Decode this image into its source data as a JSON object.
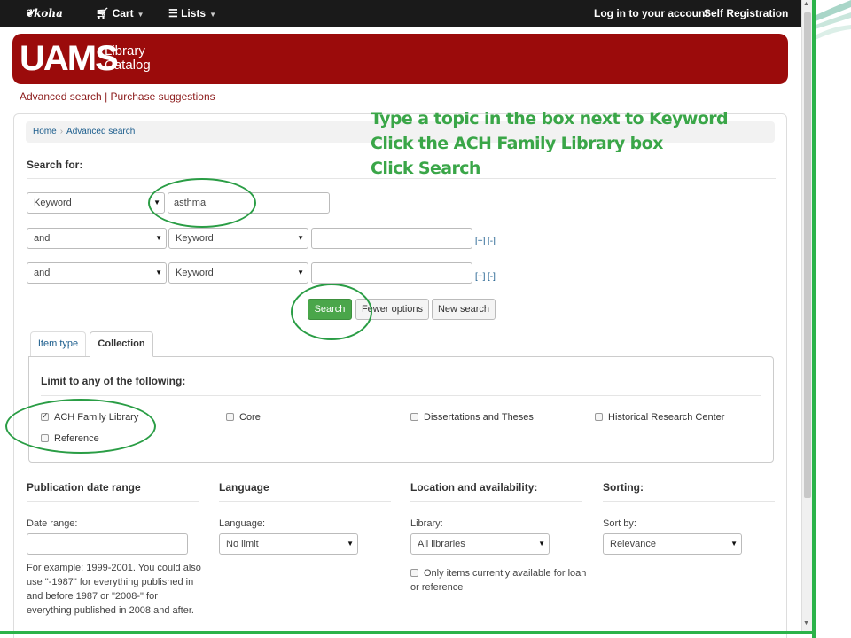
{
  "navbar": {
    "logo": "koha",
    "cart": "Cart",
    "lists": "Lists",
    "login": "Log in to your account",
    "self_registration": "Self Registration"
  },
  "banner": {
    "logo_text": "UAMS",
    "logo_sub_1": "Library",
    "logo_sub_2": "Catalog"
  },
  "subnav": {
    "advanced_search": "Advanced search",
    "separator": "|",
    "purchase_suggestions": "Purchase suggestions"
  },
  "breadcrumb": {
    "home": "Home",
    "separator": "›",
    "current": "Advanced search"
  },
  "search": {
    "heading": "Search for:",
    "rows": [
      {
        "index": "Keyword",
        "value": "asthma"
      },
      {
        "operator": "and",
        "index": "Keyword",
        "value": "",
        "add": "[+]",
        "remove": "[-]"
      },
      {
        "operator": "and",
        "index": "Keyword",
        "value": "",
        "add": "[+]",
        "remove": "[-]"
      }
    ],
    "buttons": {
      "search": "Search",
      "fewer_options": "Fewer options",
      "new_search": "New search"
    }
  },
  "tabs": {
    "item_type": "Item type",
    "collection": "Collection"
  },
  "collection": {
    "limit_label": "Limit to any of the following:",
    "options": [
      {
        "label": "ACH Family Library",
        "checked": true
      },
      {
        "label": "Core",
        "checked": false
      },
      {
        "label": "Dissertations and Theses",
        "checked": false
      },
      {
        "label": "Historical Research Center",
        "checked": false
      },
      {
        "label": "Reference",
        "checked": false
      }
    ]
  },
  "filters": {
    "pubdate": {
      "title": "Publication date range",
      "label": "Date range:",
      "example": "For example: 1999-2001. You could also use \"-1987\" for everything published in and before 1987 or \"2008-\" for everything published in 2008 and after."
    },
    "language": {
      "title": "Language",
      "label": "Language:",
      "value": "No limit"
    },
    "location": {
      "title": "Location and availability:",
      "label": "Library:",
      "value": "All libraries",
      "available_only": "Only items currently available for loan or reference"
    },
    "sorting": {
      "title": "Sorting:",
      "label": "Sort by:",
      "value": "Relevance"
    }
  },
  "annotation": {
    "line1": "Type a topic in the box next to Keyword",
    "line2": "Click the ACH Family Library box",
    "line3": "Click Search"
  },
  "colors": {
    "banner": "#9b0b0b",
    "annotation": "#3aa648",
    "search_button": "#4aa64a"
  }
}
